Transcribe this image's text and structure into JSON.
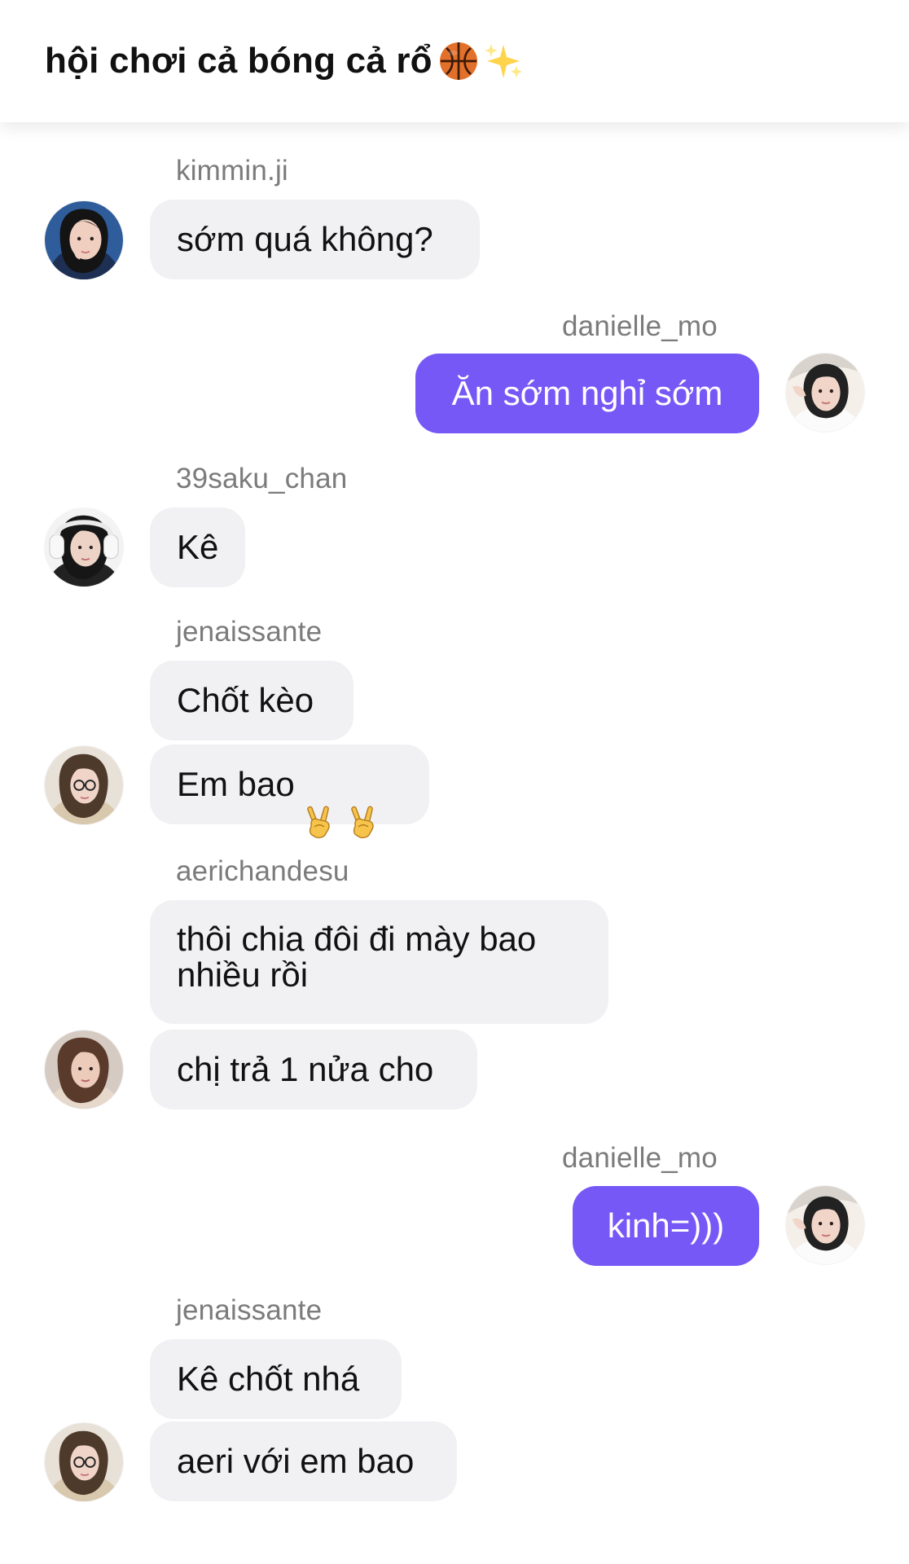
{
  "header": {
    "title": "hội chơi cả bóng cả rổ",
    "title_icons": [
      "basketball-icon",
      "sparkles-icon"
    ]
  },
  "messages": [
    {
      "sender": "kimmin.ji",
      "text": "sớm quá không?",
      "direction": "incoming"
    },
    {
      "sender": "danielle_mo",
      "text": "Ăn sớm nghỉ sớm",
      "direction": "outgoing"
    },
    {
      "sender": "39saku_chan",
      "text": "Kê",
      "direction": "incoming"
    },
    {
      "sender": "jenaissante",
      "text": "Chốt kèo",
      "direction": "incoming"
    },
    {
      "sender": "jenaissante",
      "text": "Em bao",
      "emoji": [
        "victory-hand-icon",
        "victory-hand-icon"
      ],
      "direction": "incoming"
    },
    {
      "sender": "aerichandesu",
      "text": "thôi chia đôi đi mày bao\nnhiều rồi",
      "direction": "incoming"
    },
    {
      "sender": "aerichandesu",
      "text": "chị trả 1 nửa cho",
      "direction": "incoming"
    },
    {
      "sender": "danielle_mo",
      "text": "kinh=)))",
      "direction": "outgoing"
    },
    {
      "sender": "jenaissante",
      "text": "Kê chốt nhá",
      "direction": "incoming"
    },
    {
      "sender": "jenaissante",
      "text": "aeri với em bao",
      "direction": "incoming"
    }
  ],
  "colors": {
    "outgoing_bubble": "#7658f6",
    "incoming_bubble": "#f1f1f4",
    "username": "#7b7b7b",
    "header_text": "#111111"
  }
}
